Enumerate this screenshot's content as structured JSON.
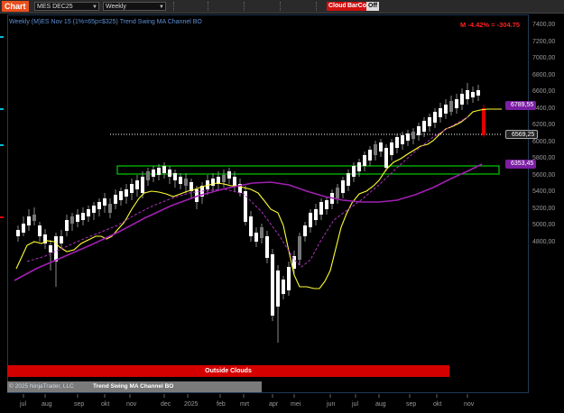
{
  "toolbar": {
    "chart_tab": "Chart",
    "instrument": "MES DEC25",
    "period": "Weekly",
    "cloud_btn": "Cloud",
    "barcol_btn": "BarCol",
    "off_btn": "Off"
  },
  "chart": {
    "title": "Weekly (M)ES Nov 15 (1%=65p=$325)   Trend Swing MA Channel BO",
    "pnl": "M -4.42% = -304.75",
    "y_ticks": [
      "7400,00",
      "7200,00",
      "7000,00",
      "6800,00",
      "6600,00",
      "6400,00",
      "6200,00",
      "6000,00",
      "5800,00",
      "5600,00",
      "5400,00",
      "5200,00",
      "5000,00",
      "4800,00"
    ],
    "x_ticks": [
      "jul",
      "aug",
      "sep",
      "okt",
      "nov",
      "dec",
      "2025",
      "feb",
      "mrt",
      "apr",
      "mei",
      "jun",
      "jul",
      "aug",
      "sep",
      "okt",
      "nov"
    ],
    "price_tags": [
      {
        "label": "6789,55",
        "color": "#7b1fa2"
      },
      {
        "label": "6569,25",
        "color": "#222222"
      },
      {
        "label": "6353,45",
        "color": "#7b1fa2"
      }
    ],
    "cloud_label": "Outside Clouds",
    "copyright": "© 2025 NinjaTrader, LLC",
    "indicator_name": "Trend Swing MA Channel BO"
  },
  "colors": {
    "accent": "#e8501e",
    "bear": "#e00000",
    "bull": "#ffffff",
    "ma_yellow": "#ffff33",
    "ma_purple": "#a020b0",
    "box_green": "#00cc00"
  }
}
